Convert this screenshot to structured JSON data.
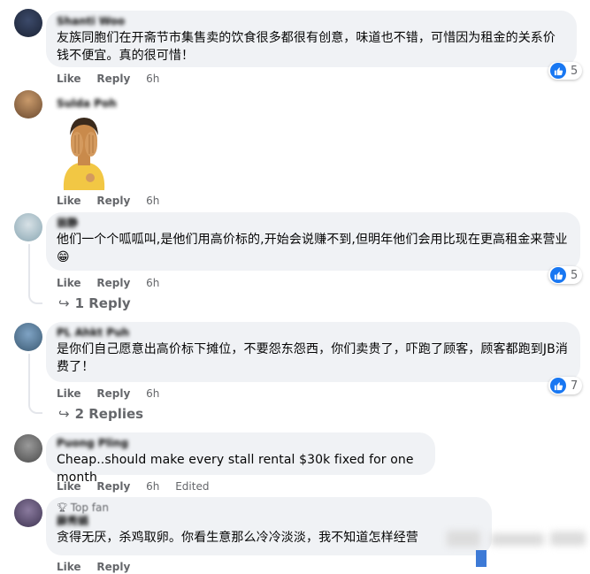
{
  "common": {
    "like_label": "Like",
    "reply_label": "Reply",
    "time": "6h",
    "edited_label": "Edited"
  },
  "comments": [
    {
      "author": "Shanti Woo",
      "text": "友族同胞们在开斋节市集售卖的饮食很多都很有创意，味道也不错，可惜因为租金的关系价钱不便宜。真的很可惜！",
      "reactions": "5"
    },
    {
      "author": "Sulda Poh",
      "sticker": "facepalm-sticker"
    },
    {
      "author": "翁静",
      "text": "他们一个个呱呱叫,是他们用高价标的,开始会说赚不到,但明年他们会用比现在更高租金来营业😁",
      "reactions": "5",
      "replies": "1 Reply"
    },
    {
      "author": "PL Ahkt Puh",
      "text": "是你们自己愿意出高价标下摊位，不要怨东怨西，你们卖贵了，吓跑了顾客，顾客都跑到JB消费了！",
      "reactions": "7",
      "replies": "2 Replies"
    },
    {
      "author": "Puong Pling",
      "text": "Cheap..should make every stall rental $30k fixed for one month",
      "edited": true
    },
    {
      "author": "Top fan",
      "badge": "Top fan",
      "subname": "薛秀娟",
      "text": "贪得无厌，杀鸡取卵。你看生意那么冷冷淡淡，我不知道怎样经营"
    }
  ],
  "colors": {
    "bubble": "#f0f2f5",
    "meta_text": "#65676b",
    "like_blue": "#1877f2",
    "thread_line": "#e4e6eb"
  },
  "icons": [
    "like-icon",
    "reply-arrow-icon",
    "top-fan-badge-icon"
  ]
}
